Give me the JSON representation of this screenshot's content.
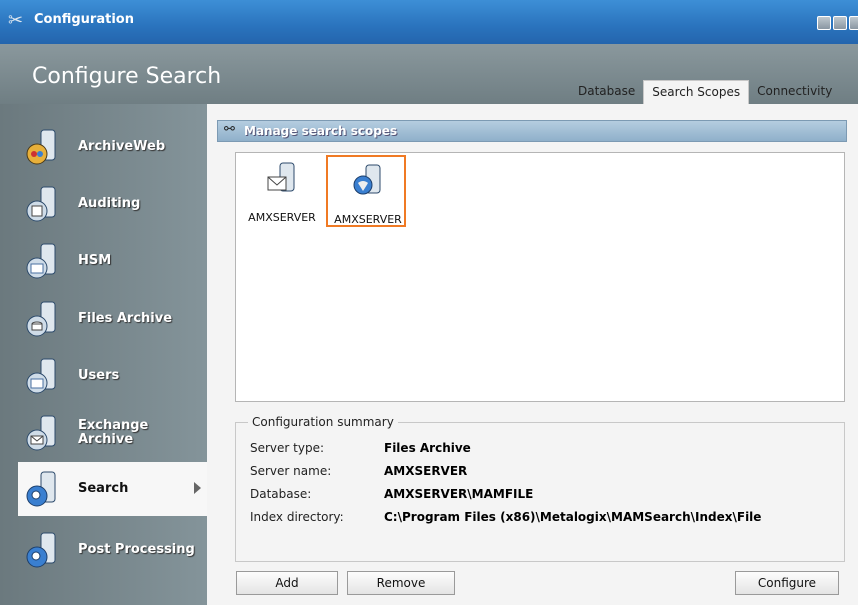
{
  "window": {
    "title": "Configuration",
    "heading": "Configure Search"
  },
  "tabs": [
    {
      "label": "Database"
    },
    {
      "label": "Search Scopes"
    },
    {
      "label": "Connectivity"
    }
  ],
  "sidebar": {
    "items": [
      {
        "label": "ArchiveWeb"
      },
      {
        "label": "Auditing"
      },
      {
        "label": "HSM"
      },
      {
        "label": "Files Archive"
      },
      {
        "label": "Users"
      },
      {
        "label": "Exchange Archive"
      },
      {
        "label": "Search"
      },
      {
        "label": "Post Processing"
      }
    ]
  },
  "section": {
    "title": "Manage search scopes"
  },
  "scopes": [
    {
      "label": "AMXSERVER"
    },
    {
      "label": "AMXSERVER"
    }
  ],
  "summary": {
    "legend": "Configuration summary",
    "server_type_label": "Server type:",
    "server_type": "Files Archive",
    "server_name_label": "Server name:",
    "server_name": "AMXSERVER",
    "database_label": "Database:",
    "database": "AMXSERVER\\MAMFILE",
    "index_dir_label": "Index directory:",
    "index_dir": "C:\\Program Files (x86)\\Metalogix\\MAMSearch\\Index\\File"
  },
  "buttons": {
    "add": "Add",
    "remove": "Remove",
    "configure": "Configure"
  },
  "colors": {
    "title_bar": "#2a73bd",
    "sidebar": "#74848a",
    "selection": "#f07a24",
    "section_bar": "#9db9d0"
  }
}
